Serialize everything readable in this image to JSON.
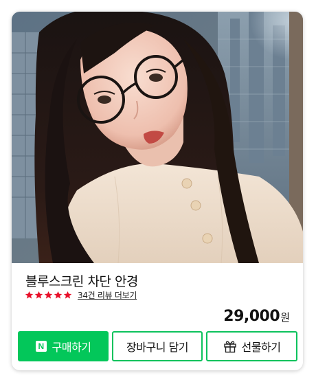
{
  "product": {
    "title": "블루스크린 차단 안경",
    "rating_stars": 5,
    "review_link": "34건 리뷰 더보기",
    "price_amount": "29,000",
    "price_unit": "원",
    "image_icon": "product-photo-woman-wearing-round-glasses"
  },
  "buttons": {
    "buy_label": "구매하기",
    "buy_logo": "N",
    "cart_label": "장바구니 담기",
    "gift_label": "선물하기",
    "gift_icon": "gift-icon"
  },
  "colors": {
    "accent_green": "#03c75a",
    "star_red": "#e8102a",
    "text": "#111111"
  }
}
